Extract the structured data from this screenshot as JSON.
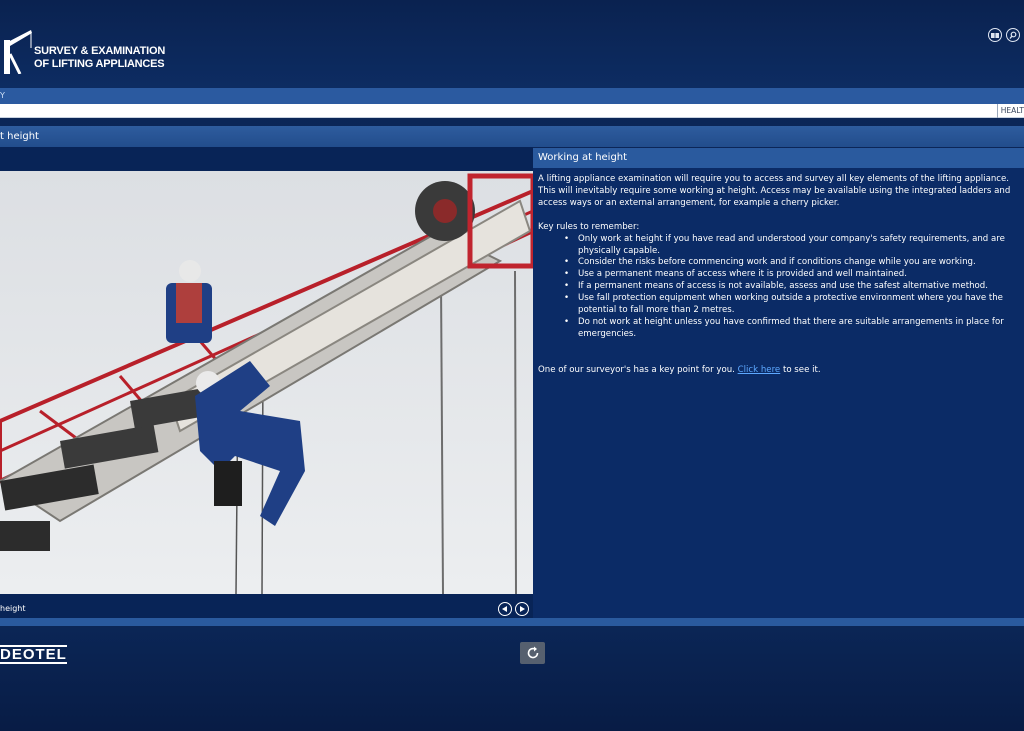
{
  "header": {
    "logo_line1": "SURVEY & EXAMINATION",
    "logo_line2": "OF LIFTING APPLIANCES",
    "icons": [
      "book-icon",
      "search-icon"
    ]
  },
  "nav": {
    "left_text": "Y"
  },
  "toolbar": {
    "right_text": "HEALT"
  },
  "page": {
    "title": "t height"
  },
  "media": {
    "caption": "height"
  },
  "content": {
    "heading": "Working at height",
    "intro": "A lifting appliance examination will require you to access and survey all key elements of the lifting appliance. This will inevitably require some working at height. Access may be available using the integrated ladders and access ways or an external arrangement, for example a cherry picker.",
    "rules_title": "Key rules to remember:",
    "rules": [
      "Only work at height if you have read and understood your company's safety requirements, and are physically capable.",
      "Consider the risks before commencing work and if conditions change while you are working.",
      "Use a permanent means of access where it is provided and well maintained.",
      "If a permanent means of access is not available, assess and use the safest alternative method.",
      "Use fall protection equipment when working outside a protective environment where you have the potential to fall more than 2 metres.",
      "Do not work at height unless you have confirmed that there are suitable arrangements in place for emergencies."
    ],
    "keypoint_pre": "One of our surveyor's has a key point for you.",
    "keypoint_link": "Click here",
    "keypoint_post": "to see it."
  },
  "footer": {
    "brand": "DEOTEL"
  },
  "colors": {
    "accent": "#2a5a9e",
    "link": "#5da8ff",
    "background": "#0b2454"
  }
}
